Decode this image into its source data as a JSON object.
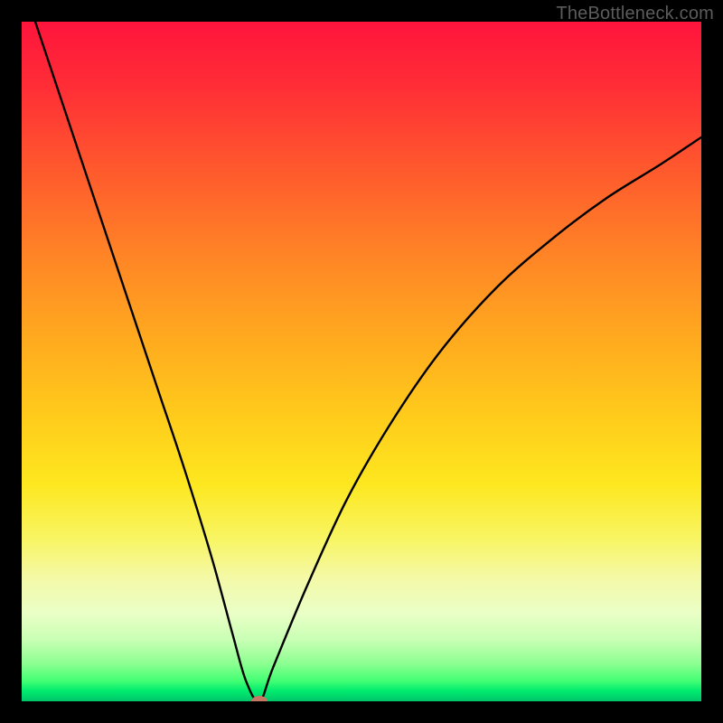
{
  "watermark": "TheBottleneck.com",
  "chart_data": {
    "type": "line",
    "title": "",
    "xlabel": "",
    "ylabel": "",
    "xlim": [
      0,
      100
    ],
    "ylim": [
      0,
      100
    ],
    "series": [
      {
        "name": "bottleneck-curve",
        "x": [
          0,
          4,
          8,
          12,
          16,
          20,
          24,
          28,
          31,
          33,
          35,
          37,
          42,
          48,
          55,
          62,
          70,
          78,
          86,
          94,
          100
        ],
        "values": [
          106,
          94,
          82,
          70,
          58,
          46,
          34,
          21,
          10,
          3,
          0,
          5,
          17,
          30,
          42,
          52,
          61,
          68,
          74,
          79,
          83
        ]
      }
    ],
    "annotations": [
      {
        "type": "point",
        "name": "optimum",
        "x": 35,
        "y": 0,
        "color": "#c77764"
      }
    ],
    "background_gradient": {
      "direction": "vertical",
      "stops": [
        {
          "pos": 0.0,
          "color": "#ff143c"
        },
        {
          "pos": 0.5,
          "color": "#ffb21e"
        },
        {
          "pos": 0.78,
          "color": "#f6f77a"
        },
        {
          "pos": 1.0,
          "color": "#00c46a"
        }
      ]
    }
  }
}
